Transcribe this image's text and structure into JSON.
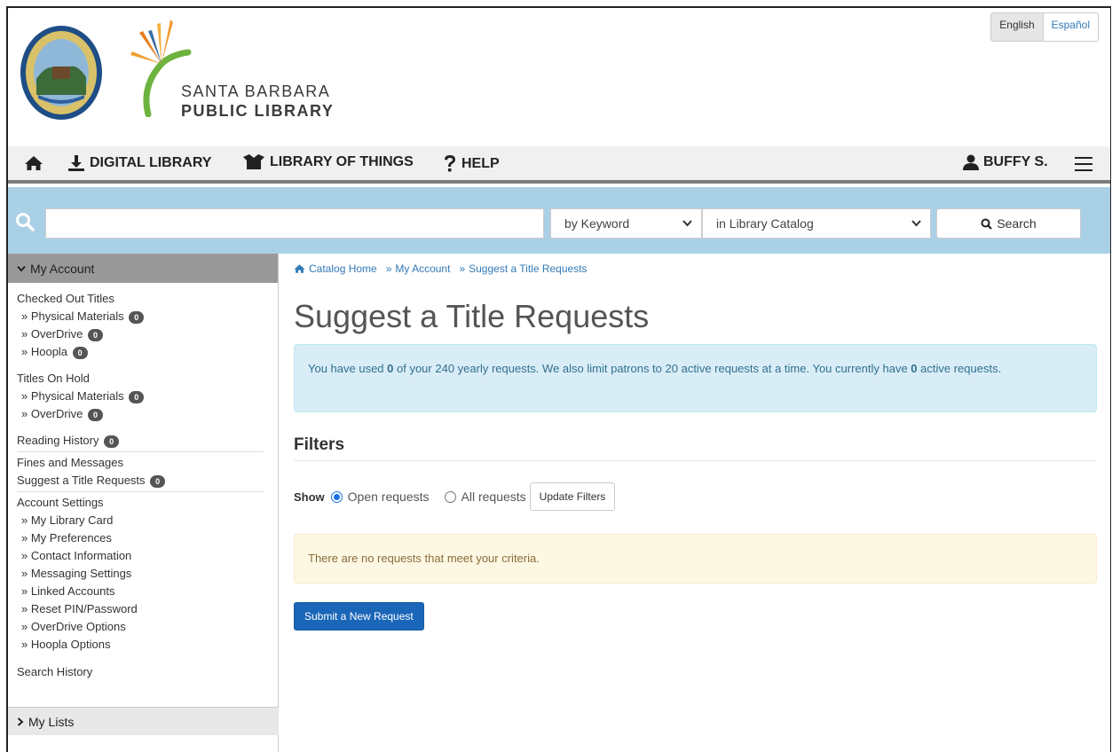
{
  "header": {
    "library_name_line1": "SANTA BARBARA",
    "library_name_line2": "PUBLIC LIBRARY",
    "languages": [
      "English",
      "Español"
    ]
  },
  "nav": {
    "items": [
      {
        "label": "",
        "icon": "home-icon"
      },
      {
        "label": "DIGITAL LIBRARY",
        "icon": "download-icon"
      },
      {
        "label": "LIBRARY OF THINGS",
        "icon": "box-open-icon"
      },
      {
        "label": "HELP",
        "icon": "question-icon"
      }
    ],
    "user": "BUFFY S.",
    "user_icon": "user-icon",
    "menu_icon": "hamburger-menu-icon"
  },
  "search": {
    "input_value": "",
    "type_selected": "by Keyword",
    "scope_selected": "in Library Catalog",
    "button_label": "Search"
  },
  "sidebar": {
    "header": "My Account",
    "checked_out": {
      "label": "Checked Out Titles",
      "items": [
        {
          "label": "Physical Materials",
          "count": "0"
        },
        {
          "label": "OverDrive",
          "count": "0"
        },
        {
          "label": "Hoopla",
          "count": "0"
        }
      ]
    },
    "on_hold": {
      "label": "Titles On Hold",
      "items": [
        {
          "label": "Physical Materials",
          "count": "0"
        },
        {
          "label": "OverDrive",
          "count": "0"
        }
      ]
    },
    "reading_history": {
      "label": "Reading History",
      "count": "0"
    },
    "fines": "Fines and Messages",
    "suggest": {
      "label": "Suggest a Title Requests",
      "count": "0"
    },
    "account_settings": {
      "label": "Account Settings",
      "items": [
        "My Library Card",
        "My Preferences",
        "Contact Information",
        "Messaging Settings",
        "Linked Accounts",
        "Reset PIN/Password",
        "OverDrive Options",
        "Hoopla Options"
      ]
    },
    "search_history": "Search History",
    "my_lists": "My Lists"
  },
  "breadcrumb": [
    "Catalog Home",
    "My Account",
    "Suggest a Title Requests"
  ],
  "main": {
    "title": "Suggest a Title Requests",
    "info_text_1": "You have used ",
    "info_used": "0",
    "info_text_2": " of your 240 yearly requests. We also limit patrons to 20 active requests at a time. You currently have ",
    "info_active": "0",
    "info_text_3": " active requests.",
    "filters_heading": "Filters",
    "show_label": "Show",
    "open_label": "Open requests",
    "all_label": "All requests",
    "selected_filter": "Open requests",
    "update_button": "Update Filters",
    "empty_message": "There are no requests that meet your criteria.",
    "submit_button": "Submit a New Request"
  },
  "colors": {
    "search_band": "#aad0e6",
    "primary_button": "#1a66b8",
    "info_bg": "#d9edf7",
    "warn_bg": "#fcf8e3"
  }
}
